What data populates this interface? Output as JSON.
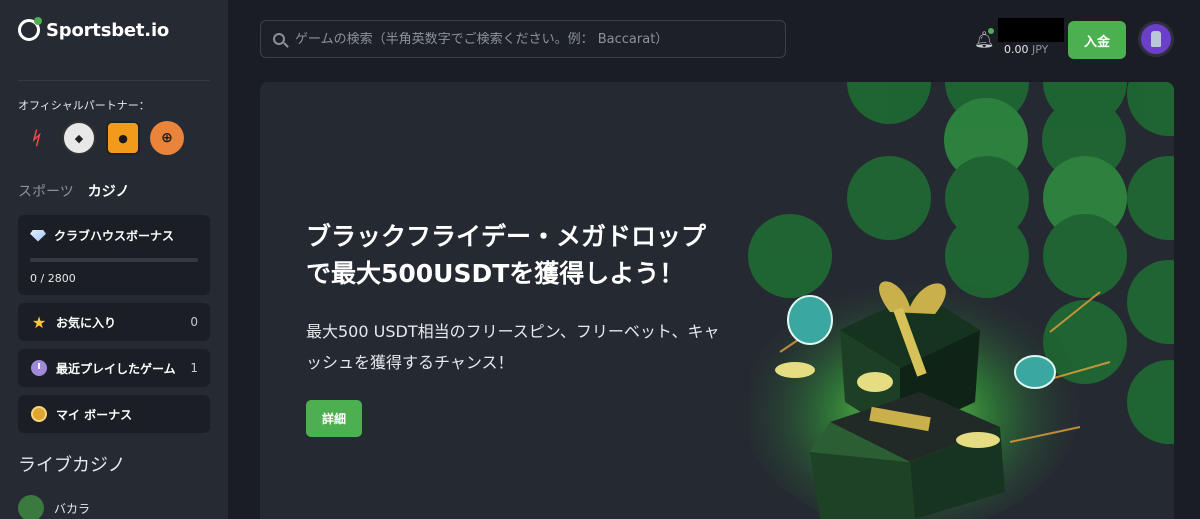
{
  "brand": {
    "name": "Sportsbet.io"
  },
  "sidebar": {
    "partners_title": "オフィシャルパートナー：",
    "partners": [
      "laliga-logo",
      "newcastle-logo",
      "hull-city-logo",
      "basketball-logo"
    ],
    "tabs": [
      {
        "label": "スポーツ",
        "active": false
      },
      {
        "label": "カジノ",
        "active": true
      }
    ],
    "club_bonus": {
      "title": "クラブハウスボーナス",
      "progress_text": "0  /  2800",
      "progress_fraction": 0
    },
    "items": [
      {
        "label": "お気に入り",
        "count": "0",
        "icon": "star-icon"
      },
      {
        "label": "最近プレイしたゲーム",
        "count": "1",
        "icon": "clock-icon"
      },
      {
        "label": "マイ ボーナス",
        "count": "",
        "icon": "medal-icon"
      }
    ],
    "section_title": "ライブカジノ",
    "live_item": {
      "label": "バカラ",
      "icon": "leaf-icon"
    }
  },
  "header": {
    "search_placeholder": "ゲームの検索（半角英数字でご検索ください。例： Baccarat）",
    "balance_amount": "0.00",
    "balance_currency": "JPY",
    "deposit_label": "入金"
  },
  "banner": {
    "title": "ブラックフライデー・メガドロップで最大500USDTを獲得しよう！",
    "subtitle": "最大500 USDT相当のフリースピン、フリーベット、キャッシュを獲得するチャンス！",
    "button_label": "詳細"
  },
  "colors": {
    "accent": "#4caf50",
    "sidebar_bg": "#262a32",
    "page_bg": "#1a1d24",
    "banner_bg": "#252932"
  }
}
